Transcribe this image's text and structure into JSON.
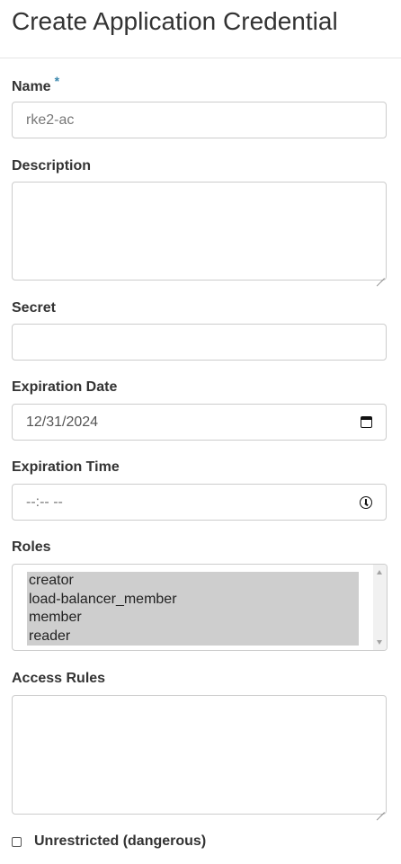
{
  "page": {
    "title": "Create Application Credential"
  },
  "fields": {
    "name": {
      "label": "Name",
      "required_marker": "*",
      "value": "rke2-ac"
    },
    "description": {
      "label": "Description",
      "value": ""
    },
    "secret": {
      "label": "Secret",
      "value": ""
    },
    "expiration_date": {
      "label": "Expiration Date",
      "value": "12/31/2024",
      "icon": "calendar-icon"
    },
    "expiration_time": {
      "label": "Expiration Time",
      "value": "--:-- --",
      "icon": "clock-icon"
    },
    "roles": {
      "label": "Roles",
      "options": [
        {
          "label": "creator",
          "selected": true
        },
        {
          "label": "load-balancer_member",
          "selected": true
        },
        {
          "label": "member",
          "selected": true
        },
        {
          "label": "reader",
          "selected": true
        }
      ]
    },
    "access_rules": {
      "label": "Access Rules",
      "value": ""
    },
    "unrestricted": {
      "label": "Unrestricted (dangerous)",
      "checked": false
    }
  },
  "colors": {
    "required_marker": "#3a87ad",
    "border": "#cccccc",
    "selected_option_bg": "#cecece"
  }
}
